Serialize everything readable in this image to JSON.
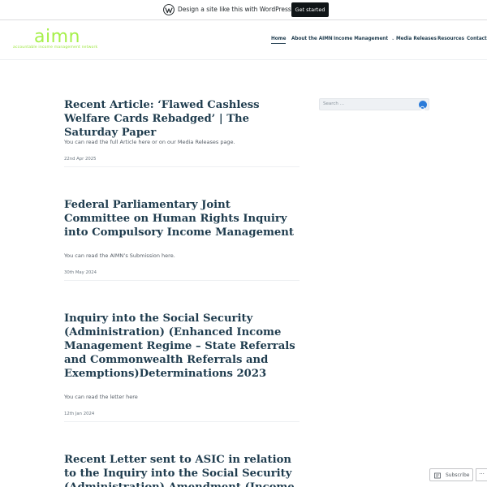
{
  "wp_bar": {
    "message": "Design a site like this with WordPress.com",
    "cta": "Get started"
  },
  "site": {
    "logo_text": "aimn",
    "logo_tagline": "accountable income management network"
  },
  "nav": {
    "items": [
      {
        "label": "Home",
        "active": true
      },
      {
        "label": "About the AIMN"
      },
      {
        "label": "Income Management",
        "has_dropdown": true
      },
      {
        "label": "Media Releases"
      },
      {
        "label": "Resources"
      },
      {
        "label": "Contact"
      }
    ]
  },
  "posts": [
    {
      "title": "Recent Article: ‘Flawed Cashless Welfare Cards Rebadged’ | The Saturday Paper",
      "excerpt": "You can read the full Article here or on our Media Releases page.",
      "date": "22nd Apr 2025"
    },
    {
      "title": "Federal Parliamentary Joint Committee on Human Rights Inquiry into Compulsory Income Management",
      "excerpt": "You can read the AIMN’s Submission here.",
      "date": "30th May 2024"
    },
    {
      "title": "Inquiry into the Social Security (Administration) (Enhanced Income Management Regime – State Referrals and Commonwealth Referrals and Exemptions)Determinations 2023",
      "excerpt": "You can read the letter here",
      "date": "12th Jan 2024"
    },
    {
      "title": "Recent Letter sent to ASIC in relation to the Inquiry into the Social Security (Administration) Amendment (Income",
      "excerpt": "",
      "date": ""
    }
  ],
  "sidebar": {
    "search_placeholder": "Search …"
  },
  "subscribe": {
    "label": "Subscribe",
    "more": "···"
  },
  "colors": {
    "logo_green": "#a6f04a",
    "text_navy": "#1f3c4e",
    "search_button": "#2b7bd9",
    "wp_button": "#101517"
  }
}
